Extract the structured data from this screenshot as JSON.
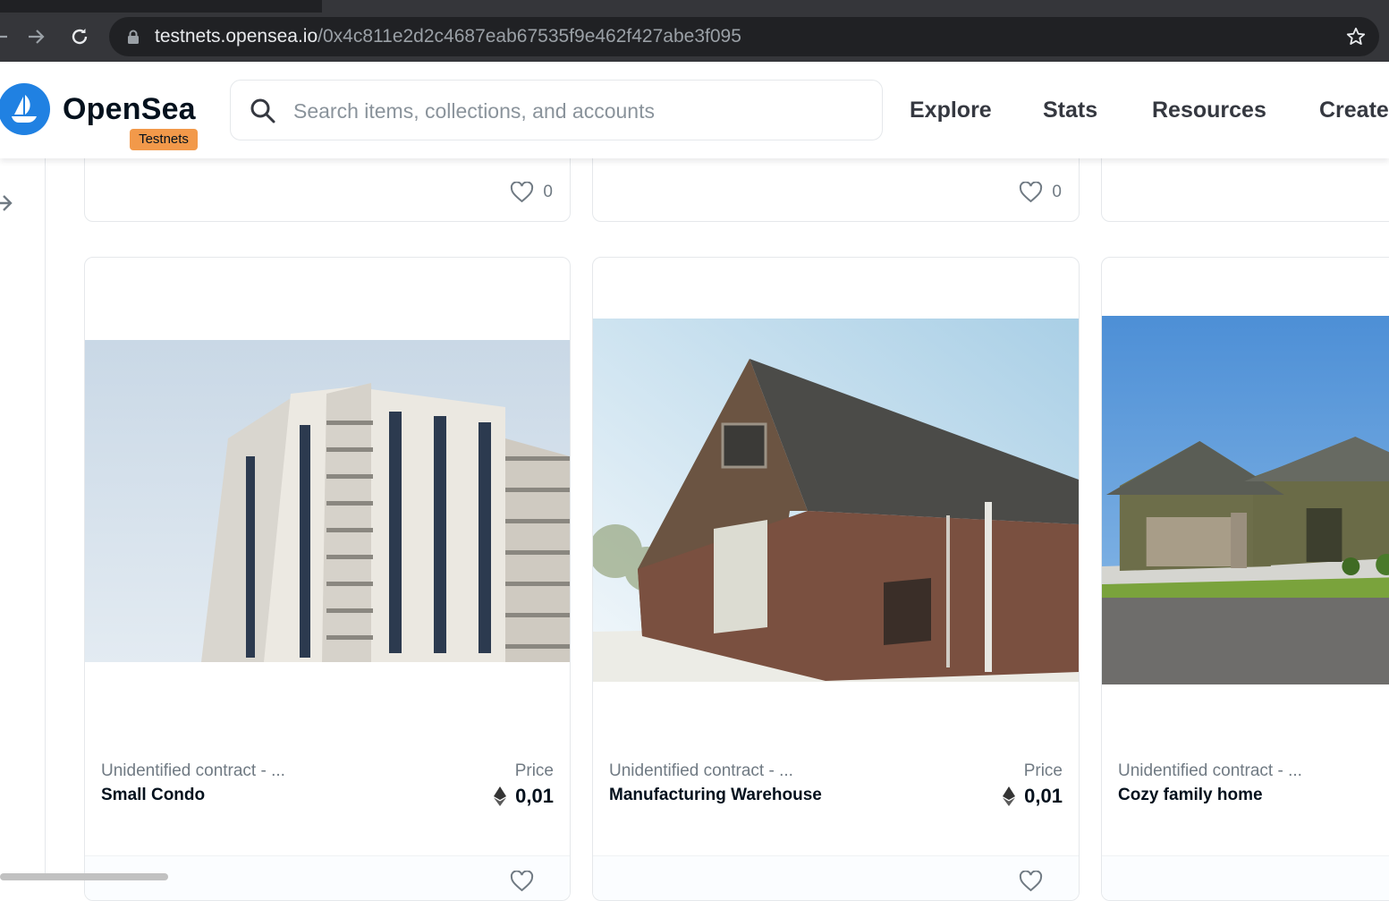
{
  "browser": {
    "url_host": "testnets.opensea.io",
    "url_path": "/0x4c811e2d2c4687eab67535f9e462f427abe3f095"
  },
  "header": {
    "brand": "OpenSea",
    "badge": "Testnets",
    "search_placeholder": "Search items, collections, and accounts",
    "nav": [
      "Explore",
      "Stats",
      "Resources",
      "Create"
    ]
  },
  "top_cards": [
    {
      "likes": "0"
    },
    {
      "likes": "0"
    },
    {
      "likes": ""
    }
  ],
  "cards": [
    {
      "collection": "Unidentified contract - ...",
      "name": "Small Condo",
      "price_label": "Price",
      "price": "0,01",
      "image": "high-rise condo building photo"
    },
    {
      "collection": "Unidentified contract - ...",
      "name": "Manufacturing Warehouse",
      "price_label": "Price",
      "price": "0,01",
      "image": "brick warehouse barn photo"
    },
    {
      "collection": "Unidentified contract - ...",
      "name": "Cozy family home",
      "price_label": "",
      "price": "",
      "image": "suburban family house photo"
    }
  ],
  "colors": {
    "brand_blue": "#2081e2",
    "badge_orange": "#f2994a",
    "text_dark": "#04111d",
    "text_muted": "#707a83",
    "border": "#e5e8eb"
  }
}
